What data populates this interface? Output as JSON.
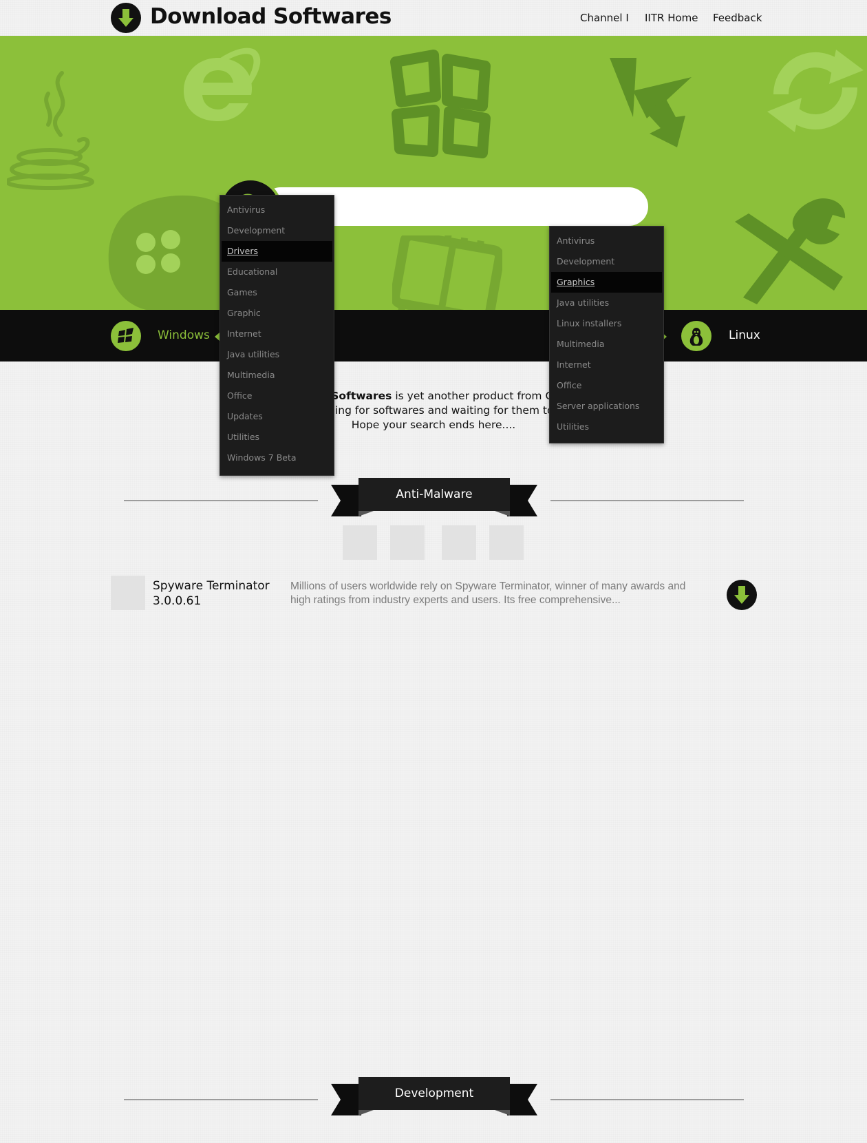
{
  "header": {
    "title": "Download Softwares",
    "nav": [
      "Channel I",
      "IITR Home",
      "Feedback"
    ]
  },
  "search": {
    "value": "",
    "placeholder": ""
  },
  "platforms": {
    "windows": "Windows",
    "linux": "Linux"
  },
  "intro": {
    "line1_bold": "Download Softwares",
    "line1_rest": " is yet another product from Channel I.",
    "line2": "No more Googling for softwares and waiting for them to download.",
    "line3": "Hope your search ends here...."
  },
  "dropdowns": {
    "windows": {
      "items": [
        "Antivirus",
        "Development",
        "Drivers",
        "Educational",
        "Games",
        "Graphic",
        "Internet",
        "Java utilities",
        "Multimedia",
        "Office",
        "Updates",
        "Utilities",
        "Windows 7 Beta"
      ],
      "active": "Drivers"
    },
    "linux": {
      "items": [
        "Antivirus",
        "Development",
        "Graphics",
        "Java utilities",
        "Linux installers",
        "Multimedia",
        "Internet",
        "Office",
        "Server applications",
        "Utilities"
      ],
      "active": "Graphics"
    }
  },
  "sections": [
    {
      "title": "Anti-Malware",
      "items": [
        {
          "name": "Spyware Terminator",
          "version": "3.0.0.61",
          "description": "Millions of users worldwide rely on Spyware Terminator, winner of many awards and high ratings from industry experts and users. Its free comprehensive..."
        }
      ]
    },
    {
      "title": "Development",
      "items": []
    }
  ],
  "colors": {
    "accent": "#8cc03a",
    "dark": "#0d0d0d",
    "menu_bg": "#1c1c1c"
  },
  "icons": {
    "logo": "download-arrow-icon",
    "search": "magnifier-icon",
    "windows": "windows-logo-icon",
    "linux": "tux-penguin-icon",
    "item_download": "download-arrow-icon"
  }
}
